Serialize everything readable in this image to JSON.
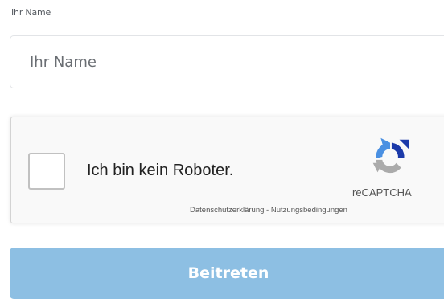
{
  "form": {
    "name_label": "Ihr Name",
    "name_input": {
      "value": "",
      "placeholder": "Ihr Name"
    },
    "submit_label": "Beitreten"
  },
  "recaptcha": {
    "checkbox_label": "Ich bin kein Roboter.",
    "brand": "reCAPTCHA",
    "privacy_link": "Datenschutzerklärung",
    "separator": " - ",
    "terms_link": "Nutzungsbedingungen",
    "checked": false
  },
  "colors": {
    "submit_bg": "#8dbfe3",
    "recaptcha_blue": "#1c3aa9",
    "recaptcha_lightblue": "#4a90e2",
    "recaptcha_gray": "#ababab"
  }
}
